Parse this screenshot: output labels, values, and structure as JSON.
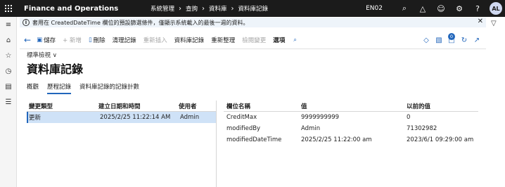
{
  "topbar": {
    "app_title": "Finance and Operations",
    "breadcrumbs": [
      "系統管理",
      "查詢",
      "資料庫",
      "資料庫記錄"
    ],
    "company": "EN02",
    "avatar_initials": "AL"
  },
  "message_bar": {
    "text": "套用在 CreatedDateTime 欄位的預設篩選條件，僅顯示系統載入的最後一週的資料。"
  },
  "action_pane": {
    "save": "儲存",
    "new": "+ 新增",
    "delete": "刪除",
    "cleanup": "清理記錄",
    "reinsert": "重新插入",
    "db_log": "資料庫記錄",
    "refresh_org": "重新整理",
    "inspect_change": "檢閱變更",
    "options": "選項",
    "notification_count": "0"
  },
  "header": {
    "view_selector": "標準檢視",
    "title": "資料庫記錄"
  },
  "tabs": [
    {
      "label": "概觀",
      "active": false
    },
    {
      "label": "歷程記錄",
      "active": true
    },
    {
      "label": "資料庫記錄的記錄計數",
      "active": false
    }
  ],
  "left_grid": {
    "headers": [
      "變更類型",
      "建立日期和時間",
      "使用者"
    ],
    "rows": [
      {
        "type": "更新",
        "created": "2025/2/25 11:22:14 AM",
        "user": "Admin"
      }
    ]
  },
  "right_grid": {
    "headers": [
      "欄位名稱",
      "值",
      "以前的值"
    ],
    "rows": [
      {
        "field": "CreditMax",
        "value": "9999999999",
        "previous": "0"
      },
      {
        "field": "modifiedBy",
        "value": "Admin",
        "previous": "71302982"
      },
      {
        "field": "modifiedDateTime",
        "value": "2025/2/25 11:22:00 am",
        "previous": "2023/6/1 09:29:00 am"
      }
    ]
  }
}
